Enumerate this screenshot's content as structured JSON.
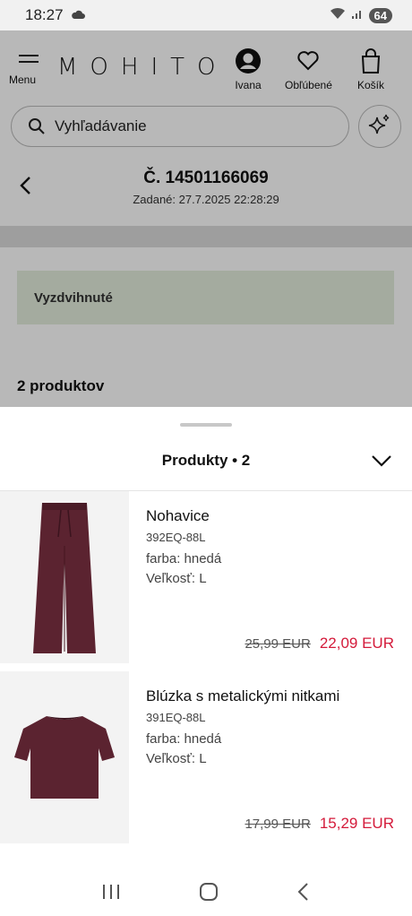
{
  "status_bar": {
    "time": "18:27",
    "battery": "64"
  },
  "header": {
    "menu_label": "Menu",
    "logo": "MOHITO",
    "account_label": "Ivana",
    "favorites_label": "Obľúbené",
    "cart_label": "Košík"
  },
  "search": {
    "placeholder": "Vyhľadávanie"
  },
  "order": {
    "number": "Č. 14501166069",
    "date": "Zadané: 27.7.2025 22:28:29",
    "status": "Vyzdvihnuté",
    "product_count": "2 produktov"
  },
  "sheet": {
    "title": "Produkty • 2",
    "products": [
      {
        "name": "Nohavice",
        "code": "392EQ-88L",
        "color": "farba: hnedá",
        "size": "Veľkosť: L",
        "old_price": "25,99 EUR",
        "new_price": "22,09 EUR"
      },
      {
        "name": "Blúzka s metalickými nitkami",
        "code": "391EQ-88L",
        "color": "farba: hnedá",
        "size": "Veľkosť: L",
        "old_price": "17,99 EUR",
        "new_price": "15,29 EUR"
      }
    ]
  },
  "colors": {
    "sale_price": "#d41a3a",
    "status_bg": "#e3eedd"
  }
}
